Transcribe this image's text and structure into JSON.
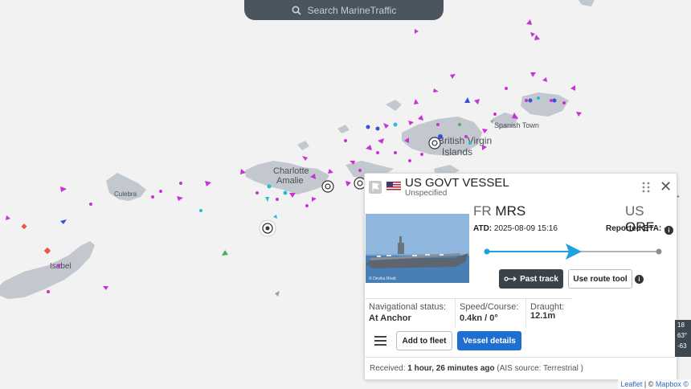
{
  "search": {
    "placeholder": "Search MarineTraffic"
  },
  "map": {
    "labels": [
      "Charlotte",
      "Amalie",
      "Culebra",
      "Isabel",
      "British Virgin",
      "Islands",
      "Spanish Town"
    ],
    "colors": {
      "sea": "#f2f2f2",
      "land": "#c2c8ce",
      "land_label": "#4a4f55"
    }
  },
  "vessel": {
    "name": "US GOVT VESSEL",
    "type": "Unspecified",
    "photo_caption": "© Devika Rhatt",
    "from_country": "FR",
    "from_port": "MRS",
    "to_country": "US",
    "to_port": "ORF",
    "atd_label": "ATD:",
    "atd_value": "2025-08-09 15:16",
    "eta_label": "Reported ETA:",
    "eta_value": "-",
    "nav_status_label": "Navigational status:",
    "nav_status_value": "At Anchor",
    "speed_label": "Speed/Course:",
    "speed_value": "0.4kn / 0°",
    "draught_label": "Draught:",
    "draught_value": "12.1m",
    "received_label": "Received:",
    "received_value": "1 hour, 26 minutes ago",
    "ais_source": "(AIS source: Terrestrial )"
  },
  "buttons": {
    "past_track": "Past track",
    "use_route_tool": "Use route tool",
    "add_to_fleet": "Add to fleet",
    "vessel_details": "Vessel details"
  },
  "right_badge": {
    "line1": "18",
    "line2": "63°",
    "line3": "-63"
  },
  "attribution": {
    "leaflet": "Leaflet",
    "sep": " | © ",
    "mapbox": "Mapbox ©"
  },
  "icons": [
    "search-icon",
    "flag-icon",
    "us-flag-icon",
    "drag-handle-icon",
    "close-icon",
    "info-icon",
    "menu-icon",
    "past-track-icon",
    "route-arrow-icon"
  ]
}
